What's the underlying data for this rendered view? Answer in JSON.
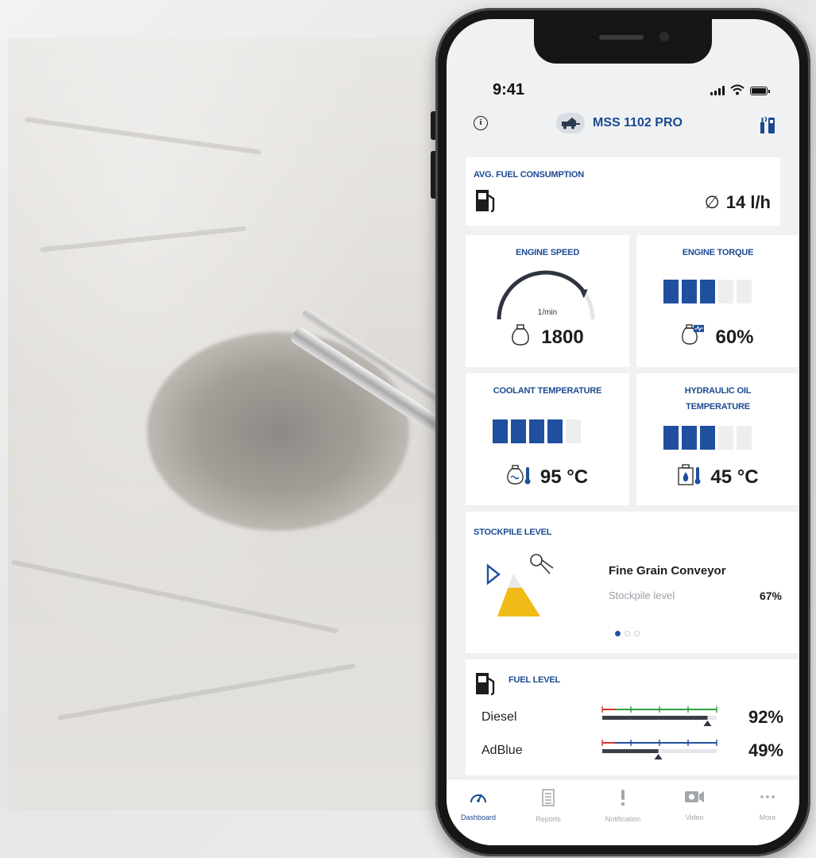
{
  "status": {
    "time": "9:41"
  },
  "header": {
    "machine_name": "MSS 1102 PRO"
  },
  "fuel_consumption": {
    "title": "AVG. FUEL CONSUMPTION",
    "symbol": "∅",
    "value": "14 l/h"
  },
  "engine_speed": {
    "title": "ENGINE SPEED",
    "unit": "1/min",
    "value": "1800",
    "gauge_fraction": 0.8
  },
  "engine_torque": {
    "title": "ENGINE TORQUE",
    "value": "60%",
    "bars_on": 3,
    "bars_total": 5
  },
  "coolant": {
    "title": "COOLANT TEMPERATURE",
    "value": "95 °C",
    "bars_on": 4,
    "bars_total": 5
  },
  "hydraulic": {
    "title_line1": "HYDRAULIC OIL",
    "title_line2": "TEMPERATURE",
    "value": "45 °C",
    "bars_on": 3,
    "bars_total": 5
  },
  "stockpile": {
    "title": "STOCKPILE LEVEL",
    "conveyor_name": "Fine Grain Conveyor",
    "label": "Stockpile level",
    "value": "67%",
    "pages": 3,
    "active_page": 0
  },
  "fuel_level": {
    "title": "FUEL LEVEL",
    "items": [
      {
        "name": "Diesel",
        "value": "92%",
        "level": 0.92,
        "scale_color": "#2ea043"
      },
      {
        "name": "AdBlue",
        "value": "49%",
        "level": 0.49,
        "scale_color": "#1f4f9e"
      }
    ]
  },
  "tabs": [
    {
      "label": "Dashboard",
      "icon": "speedometer-icon",
      "active": true
    },
    {
      "label": "Reports",
      "icon": "report-icon",
      "active": false
    },
    {
      "label": "Notification",
      "icon": "exclamation-icon",
      "active": false
    },
    {
      "label": "Video",
      "icon": "video-camera-icon",
      "active": false
    },
    {
      "label": "More",
      "icon": "more-dots-icon",
      "active": false
    }
  ],
  "colors": {
    "brand_blue": "#1c4a92",
    "bar_blue": "#1f4f9e",
    "stockpile_yellow": "#f0bb17",
    "alert_red": "#d9312b"
  }
}
